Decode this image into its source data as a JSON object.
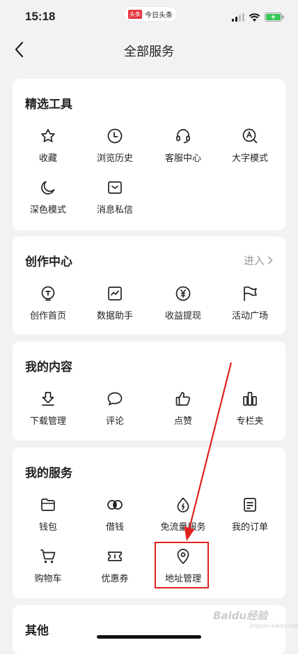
{
  "status_bar": {
    "time": "15:18",
    "app_badge": "头条",
    "app_name": "今日头条"
  },
  "nav": {
    "title": "全部服务"
  },
  "sections": {
    "tools": {
      "title": "精选工具",
      "items": [
        {
          "label": "收藏",
          "icon": "star-icon"
        },
        {
          "label": "浏览历史",
          "icon": "clock-icon"
        },
        {
          "label": "客服中心",
          "icon": "headset-icon"
        },
        {
          "label": "大字模式",
          "icon": "large-text-icon"
        },
        {
          "label": "深色模式",
          "icon": "moon-icon"
        },
        {
          "label": "消息私信",
          "icon": "message-box-icon"
        }
      ]
    },
    "creation": {
      "title": "创作中心",
      "link": "进入",
      "items": [
        {
          "label": "创作首页",
          "icon": "bulb-icon"
        },
        {
          "label": "数据助手",
          "icon": "chart-icon"
        },
        {
          "label": "收益提现",
          "icon": "yuan-icon"
        },
        {
          "label": "活动广场",
          "icon": "flag-icon"
        }
      ]
    },
    "content": {
      "title": "我的内容",
      "items": [
        {
          "label": "下载管理",
          "icon": "download-icon"
        },
        {
          "label": "评论",
          "icon": "comment-icon"
        },
        {
          "label": "点赞",
          "icon": "thumb-up-icon"
        },
        {
          "label": "专栏夹",
          "icon": "column-icon"
        }
      ]
    },
    "services": {
      "title": "我的服务",
      "items": [
        {
          "label": "钱包",
          "icon": "wallet-icon"
        },
        {
          "label": "借钱",
          "icon": "loan-icon"
        },
        {
          "label": "免流量服务",
          "icon": "data-free-icon"
        },
        {
          "label": "我的订单",
          "icon": "order-icon"
        },
        {
          "label": "购物车",
          "icon": "cart-icon"
        },
        {
          "label": "优惠券",
          "icon": "coupon-icon"
        },
        {
          "label": "地址管理",
          "icon": "location-pin-icon"
        }
      ]
    },
    "other": {
      "title": "其他"
    }
  },
  "watermark": {
    "text": "Baidu经验",
    "sub": "jingyan.baidu.com"
  },
  "colors": {
    "background": "#f2f1f4",
    "card": "#ffffff",
    "highlight": "#e1201e",
    "battery": "#34c759"
  }
}
